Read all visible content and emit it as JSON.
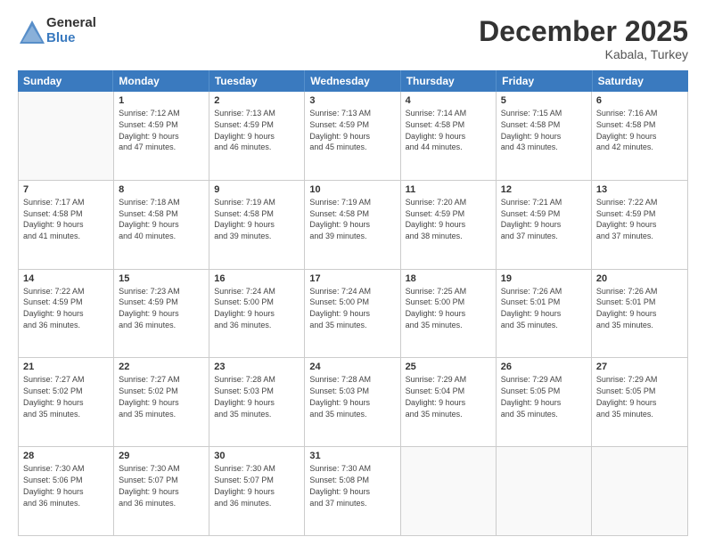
{
  "logo": {
    "general": "General",
    "blue": "Blue"
  },
  "title": "December 2025",
  "location": "Kabala, Turkey",
  "header_days": [
    "Sunday",
    "Monday",
    "Tuesday",
    "Wednesday",
    "Thursday",
    "Friday",
    "Saturday"
  ],
  "weeks": [
    [
      {
        "day": "",
        "empty": true
      },
      {
        "day": "1",
        "line1": "Sunrise: 7:12 AM",
        "line2": "Sunset: 4:59 PM",
        "line3": "Daylight: 9 hours",
        "line4": "and 47 minutes."
      },
      {
        "day": "2",
        "line1": "Sunrise: 7:13 AM",
        "line2": "Sunset: 4:59 PM",
        "line3": "Daylight: 9 hours",
        "line4": "and 46 minutes."
      },
      {
        "day": "3",
        "line1": "Sunrise: 7:13 AM",
        "line2": "Sunset: 4:59 PM",
        "line3": "Daylight: 9 hours",
        "line4": "and 45 minutes."
      },
      {
        "day": "4",
        "line1": "Sunrise: 7:14 AM",
        "line2": "Sunset: 4:58 PM",
        "line3": "Daylight: 9 hours",
        "line4": "and 44 minutes."
      },
      {
        "day": "5",
        "line1": "Sunrise: 7:15 AM",
        "line2": "Sunset: 4:58 PM",
        "line3": "Daylight: 9 hours",
        "line4": "and 43 minutes."
      },
      {
        "day": "6",
        "line1": "Sunrise: 7:16 AM",
        "line2": "Sunset: 4:58 PM",
        "line3": "Daylight: 9 hours",
        "line4": "and 42 minutes."
      }
    ],
    [
      {
        "day": "7",
        "line1": "Sunrise: 7:17 AM",
        "line2": "Sunset: 4:58 PM",
        "line3": "Daylight: 9 hours",
        "line4": "and 41 minutes."
      },
      {
        "day": "8",
        "line1": "Sunrise: 7:18 AM",
        "line2": "Sunset: 4:58 PM",
        "line3": "Daylight: 9 hours",
        "line4": "and 40 minutes."
      },
      {
        "day": "9",
        "line1": "Sunrise: 7:19 AM",
        "line2": "Sunset: 4:58 PM",
        "line3": "Daylight: 9 hours",
        "line4": "and 39 minutes."
      },
      {
        "day": "10",
        "line1": "Sunrise: 7:19 AM",
        "line2": "Sunset: 4:58 PM",
        "line3": "Daylight: 9 hours",
        "line4": "and 39 minutes."
      },
      {
        "day": "11",
        "line1": "Sunrise: 7:20 AM",
        "line2": "Sunset: 4:59 PM",
        "line3": "Daylight: 9 hours",
        "line4": "and 38 minutes."
      },
      {
        "day": "12",
        "line1": "Sunrise: 7:21 AM",
        "line2": "Sunset: 4:59 PM",
        "line3": "Daylight: 9 hours",
        "line4": "and 37 minutes."
      },
      {
        "day": "13",
        "line1": "Sunrise: 7:22 AM",
        "line2": "Sunset: 4:59 PM",
        "line3": "Daylight: 9 hours",
        "line4": "and 37 minutes."
      }
    ],
    [
      {
        "day": "14",
        "line1": "Sunrise: 7:22 AM",
        "line2": "Sunset: 4:59 PM",
        "line3": "Daylight: 9 hours",
        "line4": "and 36 minutes."
      },
      {
        "day": "15",
        "line1": "Sunrise: 7:23 AM",
        "line2": "Sunset: 4:59 PM",
        "line3": "Daylight: 9 hours",
        "line4": "and 36 minutes."
      },
      {
        "day": "16",
        "line1": "Sunrise: 7:24 AM",
        "line2": "Sunset: 5:00 PM",
        "line3": "Daylight: 9 hours",
        "line4": "and 36 minutes."
      },
      {
        "day": "17",
        "line1": "Sunrise: 7:24 AM",
        "line2": "Sunset: 5:00 PM",
        "line3": "Daylight: 9 hours",
        "line4": "and 35 minutes."
      },
      {
        "day": "18",
        "line1": "Sunrise: 7:25 AM",
        "line2": "Sunset: 5:00 PM",
        "line3": "Daylight: 9 hours",
        "line4": "and 35 minutes."
      },
      {
        "day": "19",
        "line1": "Sunrise: 7:26 AM",
        "line2": "Sunset: 5:01 PM",
        "line3": "Daylight: 9 hours",
        "line4": "and 35 minutes."
      },
      {
        "day": "20",
        "line1": "Sunrise: 7:26 AM",
        "line2": "Sunset: 5:01 PM",
        "line3": "Daylight: 9 hours",
        "line4": "and 35 minutes."
      }
    ],
    [
      {
        "day": "21",
        "line1": "Sunrise: 7:27 AM",
        "line2": "Sunset: 5:02 PM",
        "line3": "Daylight: 9 hours",
        "line4": "and 35 minutes."
      },
      {
        "day": "22",
        "line1": "Sunrise: 7:27 AM",
        "line2": "Sunset: 5:02 PM",
        "line3": "Daylight: 9 hours",
        "line4": "and 35 minutes."
      },
      {
        "day": "23",
        "line1": "Sunrise: 7:28 AM",
        "line2": "Sunset: 5:03 PM",
        "line3": "Daylight: 9 hours",
        "line4": "and 35 minutes."
      },
      {
        "day": "24",
        "line1": "Sunrise: 7:28 AM",
        "line2": "Sunset: 5:03 PM",
        "line3": "Daylight: 9 hours",
        "line4": "and 35 minutes."
      },
      {
        "day": "25",
        "line1": "Sunrise: 7:29 AM",
        "line2": "Sunset: 5:04 PM",
        "line3": "Daylight: 9 hours",
        "line4": "and 35 minutes."
      },
      {
        "day": "26",
        "line1": "Sunrise: 7:29 AM",
        "line2": "Sunset: 5:05 PM",
        "line3": "Daylight: 9 hours",
        "line4": "and 35 minutes."
      },
      {
        "day": "27",
        "line1": "Sunrise: 7:29 AM",
        "line2": "Sunset: 5:05 PM",
        "line3": "Daylight: 9 hours",
        "line4": "and 35 minutes."
      }
    ],
    [
      {
        "day": "28",
        "line1": "Sunrise: 7:30 AM",
        "line2": "Sunset: 5:06 PM",
        "line3": "Daylight: 9 hours",
        "line4": "and 36 minutes."
      },
      {
        "day": "29",
        "line1": "Sunrise: 7:30 AM",
        "line2": "Sunset: 5:07 PM",
        "line3": "Daylight: 9 hours",
        "line4": "and 36 minutes."
      },
      {
        "day": "30",
        "line1": "Sunrise: 7:30 AM",
        "line2": "Sunset: 5:07 PM",
        "line3": "Daylight: 9 hours",
        "line4": "and 36 minutes."
      },
      {
        "day": "31",
        "line1": "Sunrise: 7:30 AM",
        "line2": "Sunset: 5:08 PM",
        "line3": "Daylight: 9 hours",
        "line4": "and 37 minutes."
      },
      {
        "day": "",
        "empty": true
      },
      {
        "day": "",
        "empty": true
      },
      {
        "day": "",
        "empty": true
      }
    ]
  ]
}
